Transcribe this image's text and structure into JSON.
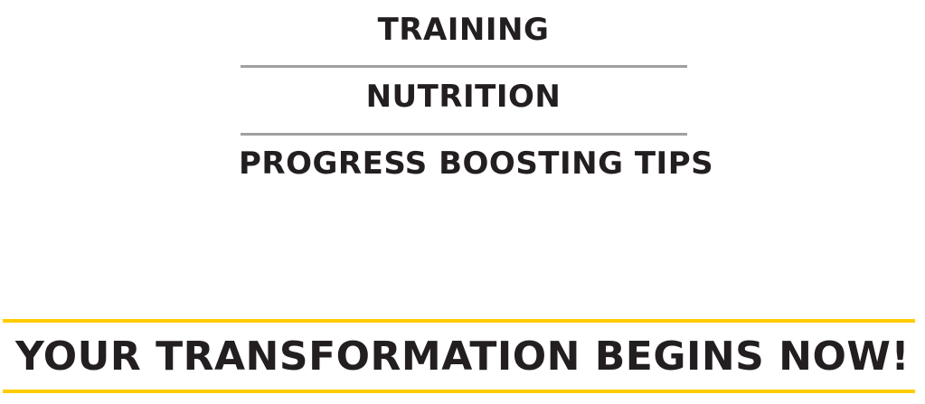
{
  "features": {
    "items": [
      {
        "label": "TRAINING"
      },
      {
        "label": "NUTRITION"
      },
      {
        "label": "PROGRESS BOOSTING TIPS"
      }
    ]
  },
  "cta": {
    "headline": "YOUR TRANSFORMATION BEGINS NOW!"
  },
  "colors": {
    "text": "#231f20",
    "divider": "#a0a0a0",
    "accent": "#ffcc00",
    "background": "#ffffff"
  }
}
